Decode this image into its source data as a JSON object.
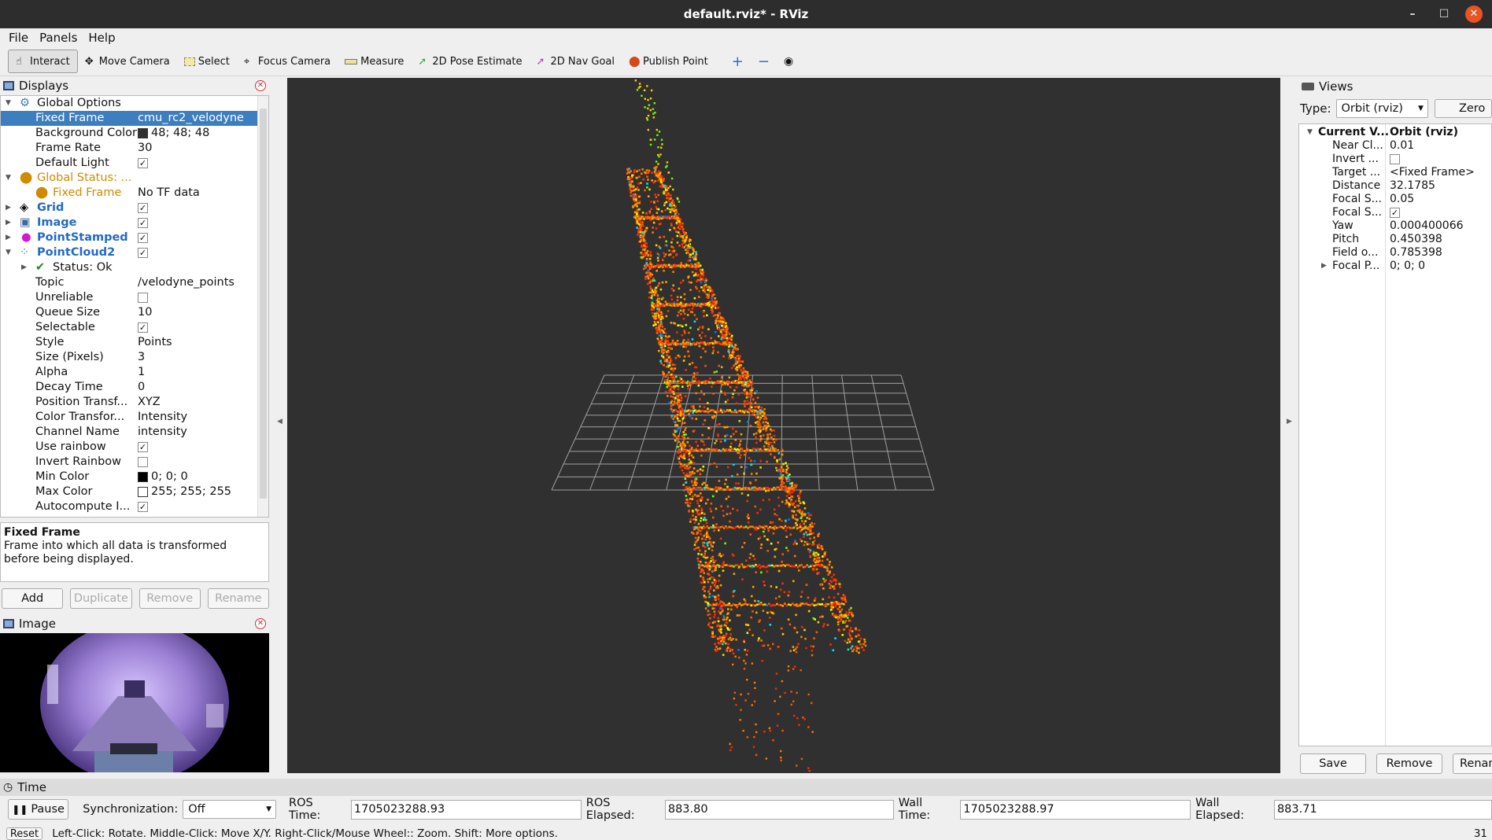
{
  "window": {
    "title": "default.rviz* - RViz",
    "min": "–",
    "max": "☐",
    "close": "✕"
  },
  "menu": [
    "File",
    "Panels",
    "Help"
  ],
  "toolbar": {
    "tools": [
      "Interact",
      "Move Camera",
      "Select",
      "Focus Camera",
      "Measure",
      "2D Pose Estimate",
      "2D Nav Goal",
      "Publish Point"
    ]
  },
  "displays": {
    "title": "Displays",
    "global_options": "Global Options",
    "fixed_frame_label": "Fixed Frame",
    "fixed_frame_value": "cmu_rc2_velodyne",
    "bg_label": "Background Color",
    "bg_value": "48; 48; 48",
    "fr_label": "Frame Rate",
    "fr_value": "30",
    "dl_label": "Default Light",
    "dl_value": "✓",
    "global_status": "Global Status: ...",
    "gs_frame_label": "Fixed Frame",
    "gs_frame_value": "No TF data",
    "grid": "Grid",
    "grid_check": "✓",
    "image": "Image",
    "image_check": "✓",
    "pointstamped": "PointStamped",
    "pointstamped_check": "✓",
    "pointcloud2": "PointCloud2",
    "pointcloud2_check": "✓",
    "status_ok": "Status: Ok",
    "topic_label": "Topic",
    "topic_value": "/velodyne_points",
    "unreliable_label": "Unreliable",
    "queue_label": "Queue Size",
    "queue_value": "10",
    "selectable_label": "Selectable",
    "selectable_value": "✓",
    "style_label": "Style",
    "style_value": "Points",
    "size_label": "Size (Pixels)",
    "size_value": "3",
    "alpha_label": "Alpha",
    "alpha_value": "1",
    "decay_label": "Decay Time",
    "decay_value": "0",
    "pos_label": "Position Transf...",
    "pos_value": "XYZ",
    "color_label": "Color Transfor...",
    "color_value": "Intensity",
    "channel_label": "Channel Name",
    "channel_value": "intensity",
    "rainbow_label": "Use rainbow",
    "rainbow_value": "✓",
    "invert_label": "Invert Rainbow",
    "min_label": "Min Color",
    "min_value": "0; 0; 0",
    "max_label": "Max Color",
    "max_value": "255; 255; 255",
    "auto_label": "Autocompute I...",
    "auto_value": "✓"
  },
  "description": {
    "title": "Fixed Frame",
    "text": "Frame into which all data is transformed before being displayed."
  },
  "display_buttons": [
    "Add",
    "Duplicate",
    "Remove",
    "Rename"
  ],
  "image_panel": {
    "title": "Image"
  },
  "views": {
    "title": "Views",
    "type_label": "Type:",
    "type_value": "Orbit (rviz)",
    "zero": "Zero",
    "current_label": "Current V...",
    "current_value": "Orbit (rviz)",
    "near_label": "Near Cl...",
    "near_value": "0.01",
    "invert_label": "Invert ...",
    "target_label": "Target ...",
    "target_value": "<Fixed Frame>",
    "distance_label": "Distance",
    "distance_value": "32.1785",
    "fs1_label": "Focal S...",
    "fs1_value": "0.05",
    "fs2_label": "Focal S...",
    "fs2_value": "✓",
    "yaw_label": "Yaw",
    "yaw_value": "0.000400066",
    "pitch_label": "Pitch",
    "pitch_value": "0.450398",
    "field_label": "Field o...",
    "field_value": "0.785398",
    "fp_label": "Focal P...",
    "fp_value": "0; 0; 0",
    "buttons": [
      "Save",
      "Remove",
      "Renam"
    ]
  },
  "time": {
    "title": "Time",
    "pause": "Pause",
    "sync_label": "Synchronization:",
    "sync_value": "Off",
    "ros_time_label": "ROS Time:",
    "ros_time": "1705023288.93",
    "ros_elapsed_label": "ROS Elapsed:",
    "ros_elapsed": "883.80",
    "wall_time_label": "Wall Time:",
    "wall_time": "1705023288.97",
    "wall_elapsed_label": "Wall Elapsed:",
    "wall_elapsed": "883.71"
  },
  "status": {
    "reset": "Reset",
    "text": "Left-Click: Rotate. Middle-Click: Move X/Y. Right-Click/Mouse Wheel:: Zoom. Shift: More options.",
    "fps": "31"
  }
}
